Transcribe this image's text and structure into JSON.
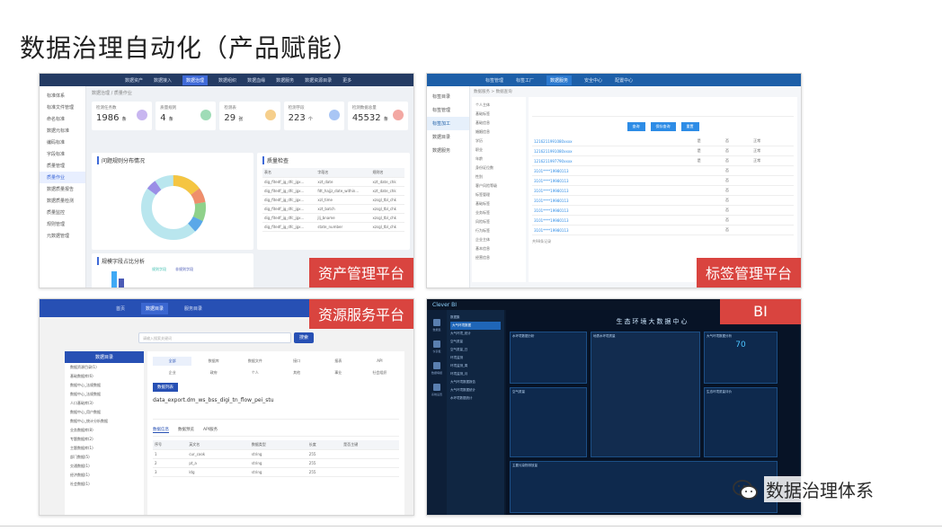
{
  "slide": {
    "title": "数据治理自动化（产品赋能）",
    "watermark": "数据治理体系"
  },
  "panels": {
    "asset": {
      "label": "资产管理平台",
      "nav": [
        "数据资产",
        "数据接入",
        "数据治理",
        "数据组织",
        "数据血缘",
        "数据服务",
        "数据资源目录",
        "更多"
      ],
      "nav_active_index": 2,
      "sidebar": [
        "标准体系",
        "标准文件管理",
        "命名标准",
        "数据元标准",
        "编码标准",
        "字段标准",
        "质量管理",
        "质量作业",
        "数据质量报告",
        "数据质量检测",
        "质量监控",
        "规则管理",
        "元数据管理"
      ],
      "sidebar_active_index": 7,
      "breadcrumb": "数据治理 / 质量作业",
      "stats": [
        {
          "label": "检测任务数",
          "value": "1986",
          "unit": "条"
        },
        {
          "label": "质量规则",
          "value": "4",
          "unit": "条"
        },
        {
          "label": "检测表",
          "value": "29",
          "unit": "张"
        },
        {
          "label": "检测字段",
          "value": "223",
          "unit": "个"
        },
        {
          "label": "检测数据总量",
          "value": "45532",
          "unit": "条"
        }
      ],
      "chart_title": "问题规则分布情况",
      "chart_date": "2021-08-19",
      "table_title": "质量检查",
      "table_headers": [
        "表名",
        "字段名",
        "规则名"
      ],
      "table_rows": [
        [
          "dig_fitedf_jg_dfc_jgx...",
          "xzt_date",
          "xzt_date_chk"
        ],
        [
          "dig_fitedf_jg_dfc_jgx...",
          "fdt_hajjz_date_within...",
          "xzt_date_chk"
        ],
        [
          "dig_fitedf_jg_dfc_jgx...",
          "xzl_time",
          "xzsgl_tbl_chk"
        ],
        [
          "dig_fitedf_jg_dfc_jgx...",
          "xzt_batch",
          "xzsgl_tbl_chk"
        ],
        [
          "dig_fitedf_jg_dfc_jgx...",
          "jlj_bname",
          "xzsgl_tbl_chk"
        ],
        [
          "dig_fitedf_jg_dfc_jgx...",
          "state_number",
          "xzsgl_tbl_chk"
        ]
      ],
      "bar_title": "规模字段占比分析",
      "bar_date": "2021-08-19",
      "legend": [
        "规则字段",
        "非规则字段"
      ]
    },
    "tag": {
      "label": "标签管理平台",
      "nav": [
        "标签管理",
        "标签工厂",
        "数据服务",
        "安全中心",
        "配置中心"
      ],
      "nav_active_index": 2,
      "sidebar": [
        "标签目录",
        "标签管理",
        "标签加工",
        "数据目录",
        "数据服务"
      ],
      "sidebar_active_index": 2,
      "breadcrumb": "数据服务 > 数据查询",
      "tree": [
        "个人主体",
        "基础标签",
        "基础信息",
        "婚姻信息",
        "学历",
        "职业",
        "年龄",
        "身份证位数",
        "性别",
        "客户风险等级",
        "标签管理",
        "基础标签",
        "业务标签",
        "风险标签",
        "行为标签",
        "企业主体",
        "基本信息",
        "经营信息"
      ],
      "buttons": [
        "查询",
        "保存查询",
        "重置"
      ],
      "ids": [
        "1216211991080xxxx",
        "1216211991080xxxx",
        "1216211997790xxxx",
        "3101****19980113",
        "3101****19980113",
        "3101****19980113",
        "3101****19980113",
        "3101****19980113",
        "3101****19980113",
        "3101****19980113",
        "3101****19980113",
        "3101****19980113"
      ],
      "page_info": "共98条记录"
    },
    "service": {
      "label": "资源服务平台",
      "nav": [
        "首页",
        "数据目录",
        "服务目录"
      ],
      "nav_active_index": 1,
      "search_placeholder": "请输入搜索关键词",
      "search_button": "搜索",
      "left_header": "数据目录",
      "left_items": [
        "数据资源目录(1)",
        "基础数据库(6)",
        "数据中心_法规数据",
        "数据中心_法规数据",
        "人口基础库(3)",
        "数据中心_用户数据",
        "数据中心_统计分析数据",
        "业务数据库(8)",
        "专题数据库(2)",
        "主题数据库(1)",
        "部门数据(5)",
        "交通数据(1)",
        "经济数据(1)",
        "社会数据(1)"
      ],
      "chips": [
        "全部",
        "数据库",
        "数据文件",
        "接口",
        "报表",
        "API",
        "企业",
        "政府",
        "个人",
        "其他",
        "事业",
        "社会组织"
      ],
      "result_tag": "数据列表",
      "dataset_name": "data_export.dm_ws_bss_digi_tn_flow_pei_stu",
      "subtabs": [
        "数据信息",
        "数据预览",
        "API服务"
      ],
      "fields_headers": [
        "序号",
        "英文名",
        "数据类型",
        "长度",
        "是否主键"
      ],
      "fields_rows": [
        [
          "1",
          "cur_cook",
          "string",
          "255",
          ""
        ],
        [
          "2",
          "pt_a",
          "string",
          "255",
          ""
        ],
        [
          "3",
          "ldg",
          "string",
          "255",
          ""
        ]
      ]
    },
    "bi": {
      "label": "BI",
      "logo": "Clever BI",
      "sidebar_labels": [
        "数据集",
        "仪表板",
        "数据填报",
        "系统设置"
      ],
      "datasets": [
        "数据集",
        "大气环境数据",
        "大气环境_统计",
        "空气质量",
        "空气质量_日",
        "环境监测",
        "环境监测_周",
        "环境监测_月",
        "大气环境数据报告",
        "大气环境数据统计",
        "水环境数据统计"
      ],
      "dashboard_title": "生态环境大数据中心",
      "kpi_value": "70",
      "tiles": [
        "水环境数据分析",
        "大气环境数据分析",
        "地表水环境质量",
        "空气质量",
        "生态环境质量评价",
        "主要污染物排放量"
      ]
    }
  }
}
